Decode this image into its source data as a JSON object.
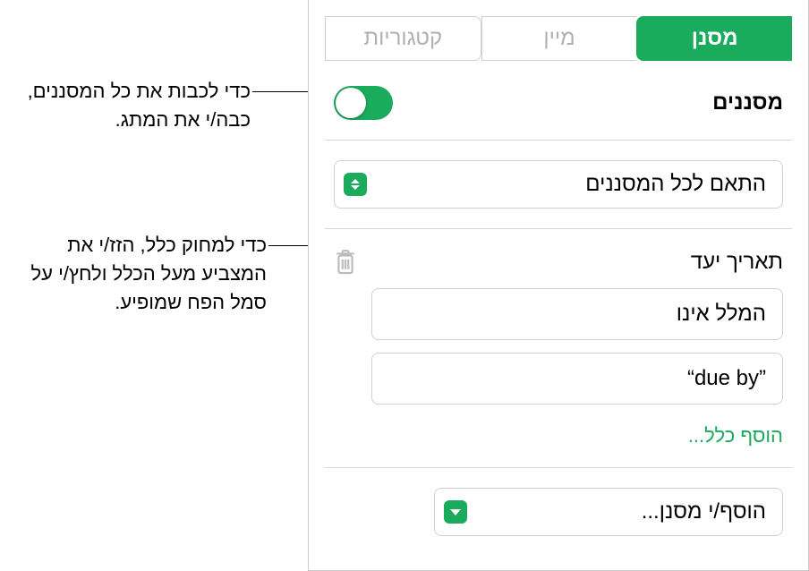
{
  "tabs": {
    "categories": "קטגוריות",
    "sort": "מיין",
    "filter": "מסנן"
  },
  "filters": {
    "title": "מסננים",
    "match_all": "התאם לכל המסננים"
  },
  "rule": {
    "title": "תאריך יעד",
    "condition": "המלל אינו",
    "value": "“due by”"
  },
  "actions": {
    "add_rule": "הוסף כלל...",
    "add_filter": "הוסף/י מסנן..."
  },
  "callouts": {
    "toggle": "כדי לכבות את כל המסננים, כבה/י את המתג.",
    "delete": "כדי למחוק כלל, הזז/י את המצביע מעל הכלל ולחץ/י על סמל הפח שמופיע."
  }
}
